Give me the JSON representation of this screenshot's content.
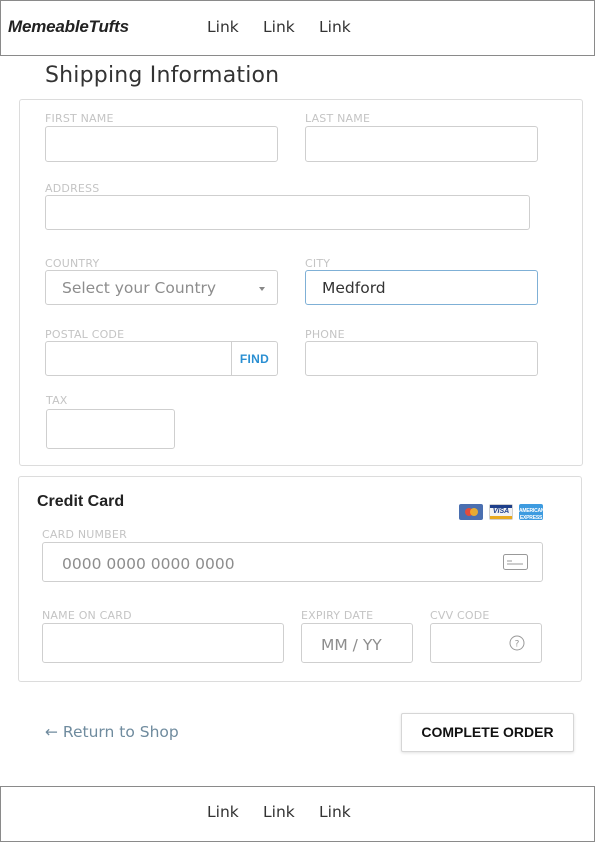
{
  "nav": {
    "brand": "MemeableTufts",
    "links": [
      "Link",
      "Link",
      "Link"
    ]
  },
  "page_title": "Shipping Information",
  "shipping": {
    "first_name": {
      "label": "FIRST NAME",
      "value": ""
    },
    "last_name": {
      "label": "LAST NAME",
      "value": ""
    },
    "address": {
      "label": "ADDRESS",
      "value": ""
    },
    "country": {
      "label": "COUNTRY",
      "placeholder": "Select your Country"
    },
    "city": {
      "label": "CITY",
      "value": "Medford"
    },
    "postal_code": {
      "label": "POSTAL CODE",
      "value": "",
      "find_label": "FIND"
    },
    "phone": {
      "label": "PHONE",
      "value": ""
    },
    "tax": {
      "label": "TAX",
      "value": ""
    }
  },
  "credit_card": {
    "title": "Credit Card",
    "logos": {
      "visa": "VISA",
      "amex": "AMERICAN EXPRESS"
    },
    "card_number": {
      "label": "CARD NUMBER",
      "placeholder": "0000 0000 0000 0000"
    },
    "name_on_card": {
      "label": "NAME ON CARD",
      "value": ""
    },
    "expiry": {
      "label": "EXPIRY DATE",
      "placeholder": "MM / YY"
    },
    "cvv": {
      "label": "CVV CODE",
      "value": ""
    }
  },
  "actions": {
    "return_label": "← Return to Shop",
    "complete_label": "COMPLETE ORDER"
  },
  "footer": {
    "links": [
      "Link",
      "Link",
      "Link"
    ]
  },
  "colors": {
    "accent": "#2a8fd2",
    "active_border": "#7fb0d6",
    "return_link": "#6f8b9e"
  }
}
